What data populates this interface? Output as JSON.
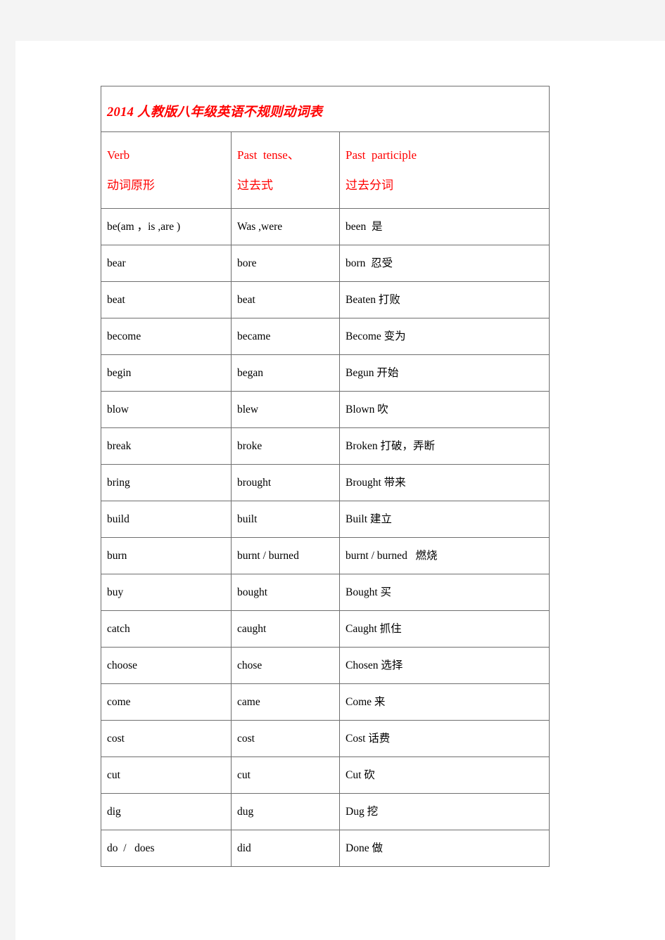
{
  "document": {
    "title": "2014 人教版八年级英语不规则动词表",
    "title_color": "#ff0000",
    "body_text_color": "#000000",
    "border_color": "#6f6f6f"
  },
  "table": {
    "headers": [
      {
        "en": "Verb",
        "cn": "动词原形"
      },
      {
        "en": "Past  tense、",
        "cn": "过去式"
      },
      {
        "en": "Past  participle",
        "cn": "过去分词"
      }
    ],
    "rows": [
      {
        "verb": "be(am ，is ,are )",
        "past": "Was ,were",
        "participle": "been  是",
        "small": false
      },
      {
        "verb": "bear",
        "past": "bore",
        "participle": "born  忍受",
        "small": false
      },
      {
        "verb": "beat",
        "past": "beat",
        "participle": "Beaten 打败",
        "small": false
      },
      {
        "verb": "become",
        "past": "became",
        "participle": "Become 变为",
        "small": false
      },
      {
        "verb": "begin",
        "past": "began",
        "participle": "Begun 开始",
        "small": false
      },
      {
        "verb": "blow",
        "past": "blew",
        "participle": "Blown 吹",
        "small": false
      },
      {
        "verb": "break",
        "past": "broke",
        "participle": "Broken 打破，弄断",
        "small": false
      },
      {
        "verb": "bring",
        "past": "brought",
        "participle": "Brought 带来",
        "small": false
      },
      {
        "verb": "build",
        "past": "built",
        "participle": "Built 建立",
        "small": false
      },
      {
        "verb": "burn",
        "past": "burnt / burned",
        "participle": "burnt / burned   燃烧",
        "small": true
      },
      {
        "verb": "buy",
        "past": "bought",
        "participle": "Bought 买",
        "small": false
      },
      {
        "verb": "catch",
        "past": "caught",
        "participle": "Caught 抓住",
        "small": false
      },
      {
        "verb": "choose",
        "past": "chose",
        "participle": "Chosen 选择",
        "small": false
      },
      {
        "verb": "come",
        "past": "came",
        "participle": "Come 来",
        "small": false
      },
      {
        "verb": "cost",
        "past": "cost",
        "participle": "Cost 话费",
        "small": false
      },
      {
        "verb": "cut",
        "past": "cut",
        "participle": "Cut 砍",
        "small": false
      },
      {
        "verb": "dig",
        "past": "dug",
        "participle": "Dug 挖",
        "small": false
      },
      {
        "verb": "do  /   does",
        "past": "did",
        "participle": "Done 做",
        "small": false
      }
    ]
  }
}
